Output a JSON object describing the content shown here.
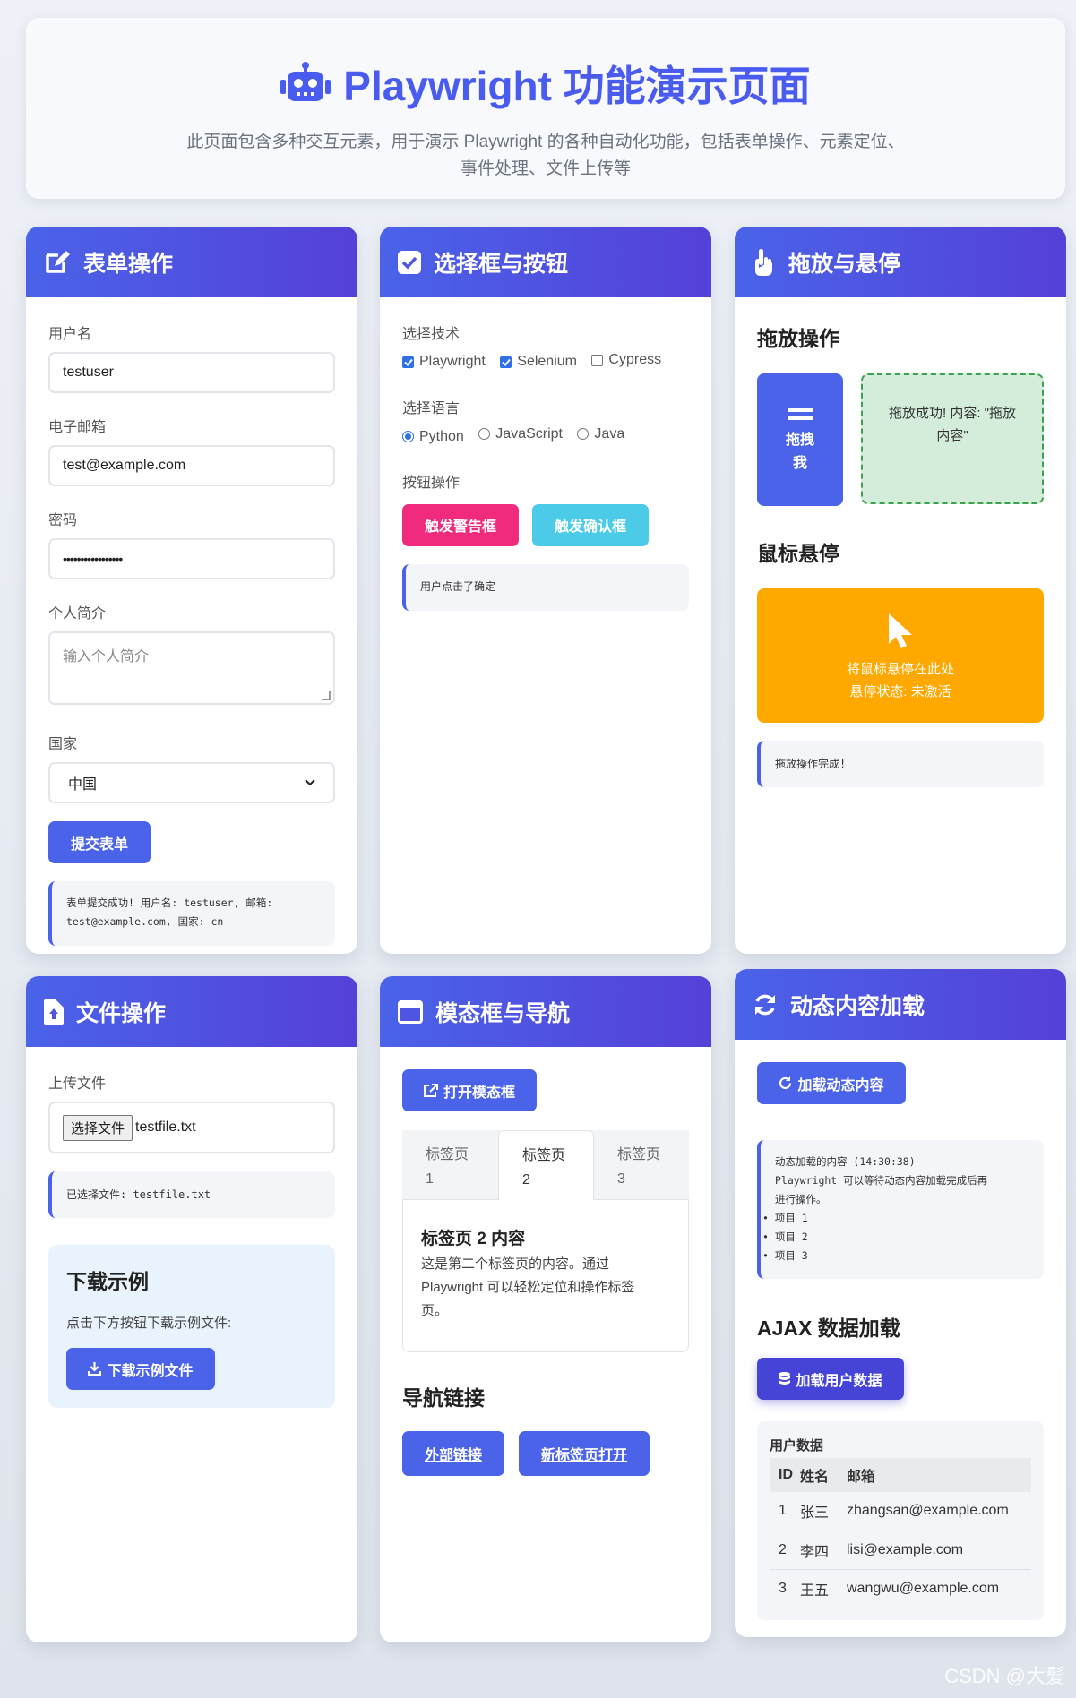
{
  "header": {
    "title": "Playwright 功能演示页面",
    "subtitle": "此页面包含多种交互元素，用于演示 Playwright 的各种自动化功能，包括表单操作、元素定位、事件处理、文件上传等"
  },
  "form_card": {
    "title": "表单操作",
    "username_label": "用户名",
    "username_value": "testuser",
    "email_label": "电子邮箱",
    "email_value": "test@example.com",
    "password_label": "密码",
    "password_value": "•••••••••••••••••",
    "bio_label": "个人简介",
    "bio_placeholder": "输入个人简介",
    "country_label": "国家",
    "country_value": "中国",
    "submit_label": "提交表单",
    "result_line1": "表单提交成功! 用户名: testuser, 邮箱:",
    "result_line2": "test@example.com, 国家: cn"
  },
  "select_card": {
    "title": "选择框与按钮",
    "tech_label": "选择技术",
    "techs": [
      {
        "label": "Playwright",
        "checked": true
      },
      {
        "label": "Selenium",
        "checked": true
      },
      {
        "label": "Cypress",
        "checked": false
      }
    ],
    "lang_label": "选择语言",
    "langs": [
      {
        "label": "Python",
        "checked": true
      },
      {
        "label": "JavaScript",
        "checked": false
      },
      {
        "label": "Java",
        "checked": false
      }
    ],
    "buttons_label": "按钮操作",
    "alert_btn": "触发警告框",
    "confirm_btn": "触发确认框",
    "result": "用户点击了确定"
  },
  "drag_card": {
    "title": "拖放与悬停",
    "drag_heading": "拖放操作",
    "drag_item_line1": "拖拽",
    "drag_item_line2": "我",
    "drop_text": "拖放成功! 内容: \"拖放内容\"",
    "hover_heading": "鼠标悬停",
    "hover_line1": "将鼠标悬停在此处",
    "hover_line2": "悬停状态: 未激活",
    "result": "拖放操作完成!"
  },
  "file_card": {
    "title": "文件操作",
    "upload_label": "上传文件",
    "choose_btn": "选择文件",
    "file_name": "testfile.txt",
    "selected": "已选择文件: testfile.txt",
    "download_heading": "下载示例",
    "download_desc": "点击下方按钮下载示例文件:",
    "download_btn": "下载示例文件"
  },
  "modal_card": {
    "title": "模态框与导航",
    "open_btn": "打开模态框",
    "tabs": [
      {
        "line1": "标签页",
        "line2": "1"
      },
      {
        "line1": "标签页",
        "line2": "2"
      },
      {
        "line1": "标签页",
        "line2": "3"
      }
    ],
    "tab_content_title": "标签页 2 内容",
    "tab_content_line1": "这是第二个标签页的内容。通过",
    "tab_content_line2": "Playwright 可以轻松定位和操作标签",
    "tab_content_line3": "页。",
    "nav_heading": "导航链接",
    "external_link": "外部链接",
    "newtab_link": "新标签页打开"
  },
  "dynamic_card": {
    "title": "动态内容加载",
    "load_btn": "加载动态内容",
    "content_line1": "动态加载的内容 (14:30:38)",
    "content_line2": "Playwright 可以等待动态内容加载完成后再",
    "content_line3": "进行操作。",
    "items": [
      "项目 1",
      "项目 2",
      "项目 3"
    ],
    "ajax_heading": "AJAX 数据加载",
    "ajax_btn": "加载用户数据",
    "table_title": "用户数据",
    "columns": [
      "ID",
      "姓名",
      "邮箱"
    ],
    "rows": [
      [
        "1",
        "张三",
        "zhangsan@example.com"
      ],
      [
        "2",
        "李四",
        "lisi@example.com"
      ],
      [
        "3",
        "王五",
        "wangwu@example.com"
      ]
    ]
  },
  "watermark": "CSDN @大髪",
  "colors": {
    "primary": "#4a63e8",
    "pink": "#f02b7d",
    "cyan": "#4ccbe8",
    "orange": "#ffa800",
    "drop_bg": "#d4edda"
  }
}
